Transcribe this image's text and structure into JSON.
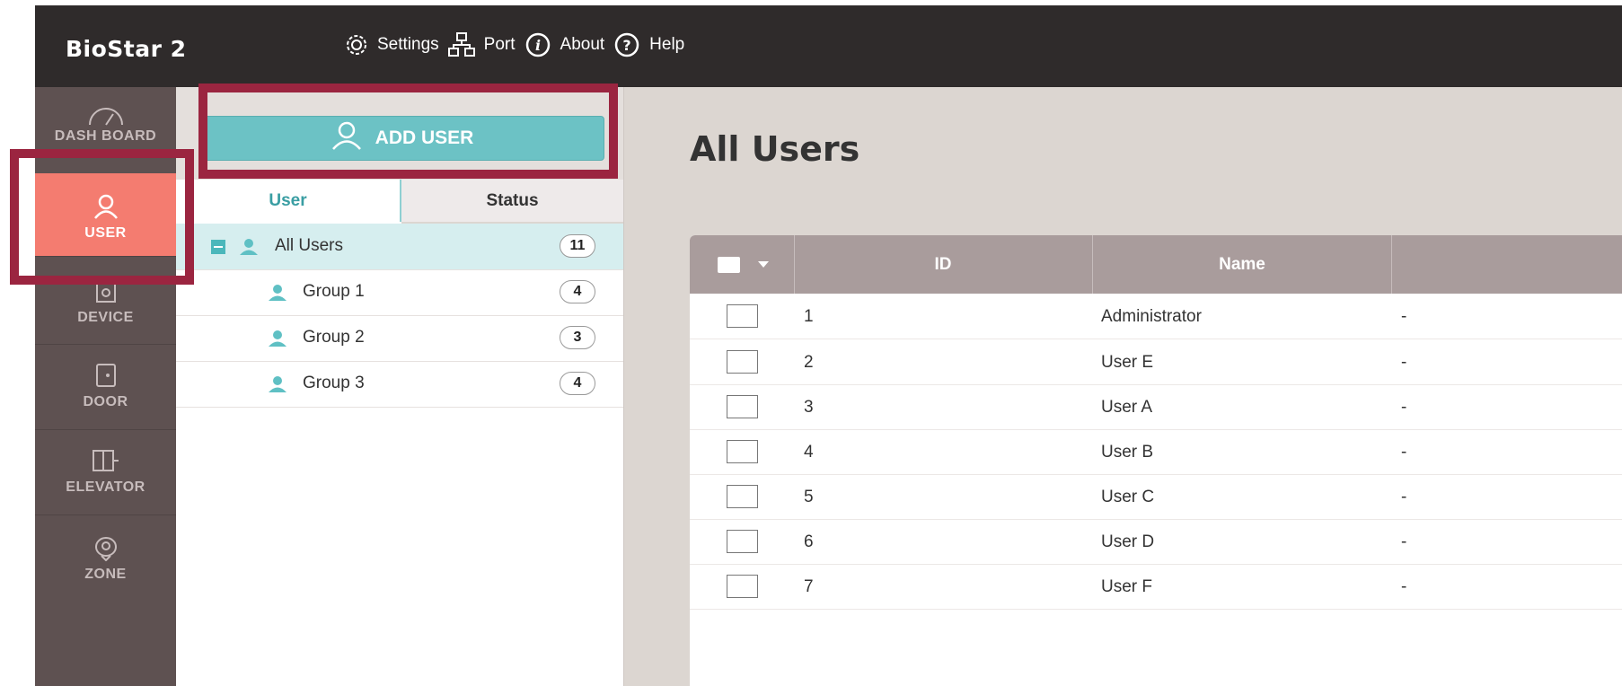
{
  "header": {
    "brand": "BioStar 2",
    "nav": [
      {
        "label": "Settings",
        "icon": "gear-icon"
      },
      {
        "label": "Port",
        "icon": "network-icon"
      },
      {
        "label": "About",
        "icon": "info-icon"
      },
      {
        "label": "Help",
        "icon": "help-icon"
      }
    ]
  },
  "rail": {
    "items": [
      {
        "label": "DASH BOARD",
        "icon": "dashboard-gauge-icon"
      },
      {
        "label": "USER",
        "icon": "user-icon",
        "active": true
      },
      {
        "label": "DEVICE",
        "icon": "device-icon"
      },
      {
        "label": "DOOR",
        "icon": "door-icon"
      },
      {
        "label": "ELEVATOR",
        "icon": "elevator-icon"
      },
      {
        "label": "ZONE",
        "icon": "zone-icon"
      }
    ]
  },
  "panel": {
    "add_user_label": "ADD USER",
    "tabs": [
      {
        "label": "User",
        "active": true
      },
      {
        "label": "Status"
      }
    ],
    "groups": [
      {
        "name": "All Users",
        "count": "11"
      },
      {
        "name": "Group 1",
        "count": "4"
      },
      {
        "name": "Group 2",
        "count": "3"
      },
      {
        "name": "Group 3",
        "count": "4"
      }
    ]
  },
  "main": {
    "title": "All Users",
    "columns": [
      "ID",
      "Name"
    ],
    "rows": [
      {
        "id": "1",
        "name": "Administrator",
        "extra": "-"
      },
      {
        "id": "2",
        "name": "User E",
        "extra": "-"
      },
      {
        "id": "3",
        "name": "User A",
        "extra": "-"
      },
      {
        "id": "4",
        "name": "User B",
        "extra": "-"
      },
      {
        "id": "5",
        "name": "User C",
        "extra": "-"
      },
      {
        "id": "6",
        "name": "User D",
        "extra": "-"
      },
      {
        "id": "7",
        "name": "User F",
        "extra": "-"
      }
    ]
  },
  "colors": {
    "topbar": "#2f2b2b",
    "rail": "#5e5151",
    "accent_active": "#f47c70",
    "button_teal": "#6cc2c5",
    "highlight_box": "#9b2540"
  }
}
